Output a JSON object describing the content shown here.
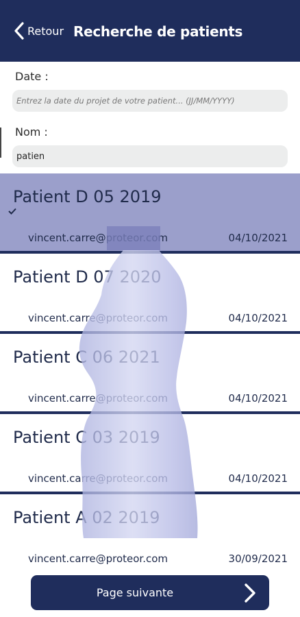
{
  "header": {
    "back_label": "Retour",
    "back_icon": "chevron-left-icon",
    "title": "Recherche de patients"
  },
  "form": {
    "date_label": "Date :",
    "date_placeholder": "Entrez la date du projet de votre patient... (JJ/MM/YYYY)",
    "date_value": "",
    "name_label": "Nom :",
    "name_value": "patien"
  },
  "results": [
    {
      "name": "Patient D 05 2019",
      "email": "vincent.carre@proteor.com",
      "date": "04/10/2021",
      "selected": true
    },
    {
      "name": "Patient D 07 2020",
      "email": "vincent.carre@proteor.com",
      "date": "04/10/2021",
      "selected": false
    },
    {
      "name": "Patient C 06 2021",
      "email": "vincent.carre@proteor.com",
      "date": "04/10/2021",
      "selected": false
    },
    {
      "name": "Patient C 03 2019",
      "email": "vincent.carre@proteor.com",
      "date": "04/10/2021",
      "selected": false
    },
    {
      "name": "Patient A 02 2019",
      "email": "vincent.carre@proteor.com",
      "date": "30/09/2021",
      "selected": false
    }
  ],
  "footer": {
    "next_label": "Page suivante",
    "next_icon": "chevron-right-icon"
  },
  "colors": {
    "header": "#1f2d5c",
    "selected_row": "#9b9fcb",
    "field_bg": "#eceded",
    "torso": "#b9bde6"
  }
}
